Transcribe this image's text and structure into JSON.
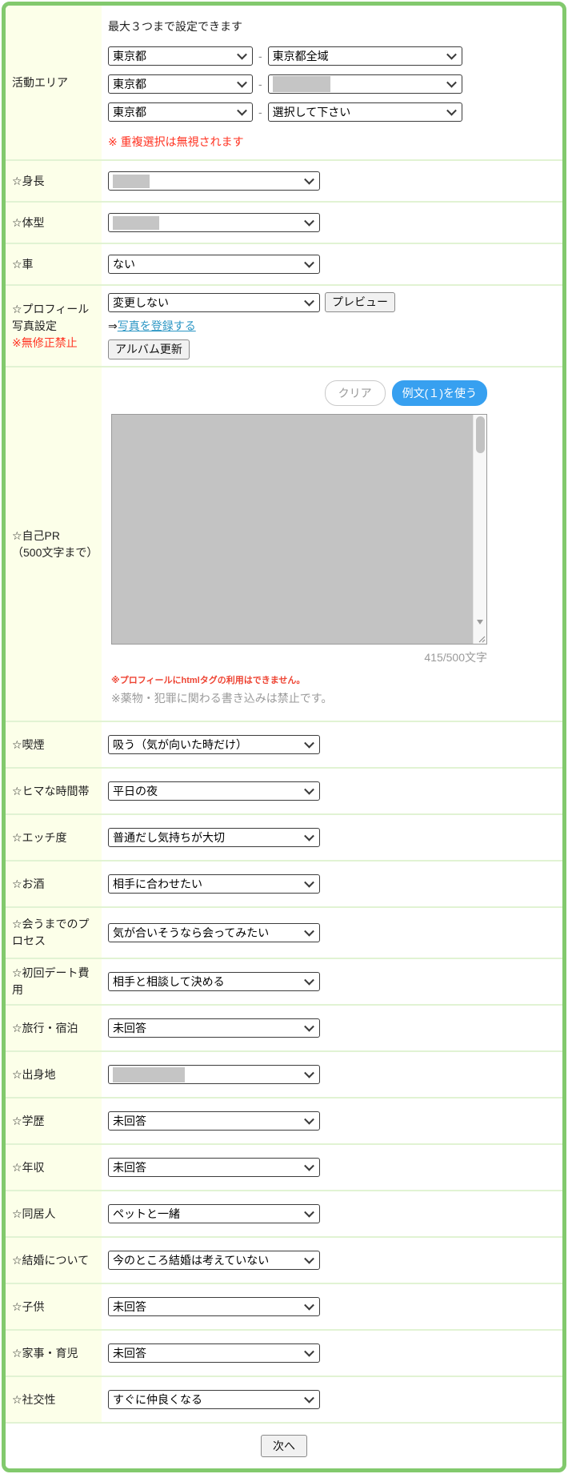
{
  "colors": {
    "frame_green": "#82c96d",
    "separator_green": "#e1f3d3",
    "label_bg": "#fcffe9",
    "warning_red": "#f32",
    "link_blue": "#2b96c4",
    "example_button_blue": "#37a0f0",
    "redaction_gray": "#c5c5c5"
  },
  "area": {
    "label": "活動エリア",
    "hint": "最大３つまで設定できます",
    "dash": "-",
    "rows": [
      {
        "pref": "東京都",
        "region": "東京都全域"
      },
      {
        "pref": "東京都",
        "region": ""
      },
      {
        "pref": "東京都",
        "region": "選択して下さい"
      }
    ],
    "warning": "※ 重複選択は無視されます"
  },
  "fields_top": [
    {
      "label": "☆身長",
      "value": ""
    },
    {
      "label": "☆体型",
      "value": ""
    },
    {
      "label": "☆車",
      "value": "ない"
    }
  ],
  "photo": {
    "label": "☆プロフィール写真設定",
    "label_note": "※無修正禁止",
    "select_value": "変更しない",
    "preview_button": "プレビュー",
    "register_arrow": "⇒",
    "register_link": "写真を登録する",
    "album_button": "アルバム更新"
  },
  "pr": {
    "label_line1": "☆自己PR",
    "label_line2": "（500文字まで）",
    "clear_button": "クリア",
    "example_button": "例文(１)を使う",
    "counter": "415/500文字",
    "note_html": "※プロフィールにhtmlタグの利用はできません。",
    "note_rules": "※薬物・犯罪に関わる書き込みは禁止です。"
  },
  "fields_bottom": [
    {
      "label": "☆喫煙",
      "value": "吸う（気が向いた時だけ）"
    },
    {
      "label": "☆ヒマな時間帯",
      "value": "平日の夜"
    },
    {
      "label": "☆エッチ度",
      "value": "普通だし気持ちが大切"
    },
    {
      "label": "☆お酒",
      "value": "相手に合わせたい"
    },
    {
      "label": "☆会うまでのプロセス",
      "value": "気が合いそうなら会ってみたい"
    },
    {
      "label": "☆初回デート費用",
      "value": "相手と相談して決める"
    },
    {
      "label": "☆旅行・宿泊",
      "value": "未回答"
    },
    {
      "label": "☆出身地",
      "value": ""
    },
    {
      "label": "☆学歴",
      "value": "未回答"
    },
    {
      "label": "☆年収",
      "value": "未回答"
    },
    {
      "label": "☆同居人",
      "value": "ペットと一緒"
    },
    {
      "label": "☆結婚について",
      "value": "今のところ結婚は考えていない"
    },
    {
      "label": "☆子供",
      "value": "未回答"
    },
    {
      "label": "☆家事・育児",
      "value": "未回答"
    },
    {
      "label": "☆社交性",
      "value": "すぐに仲良くなる"
    }
  ],
  "footer": {
    "next_button": "次へ"
  }
}
